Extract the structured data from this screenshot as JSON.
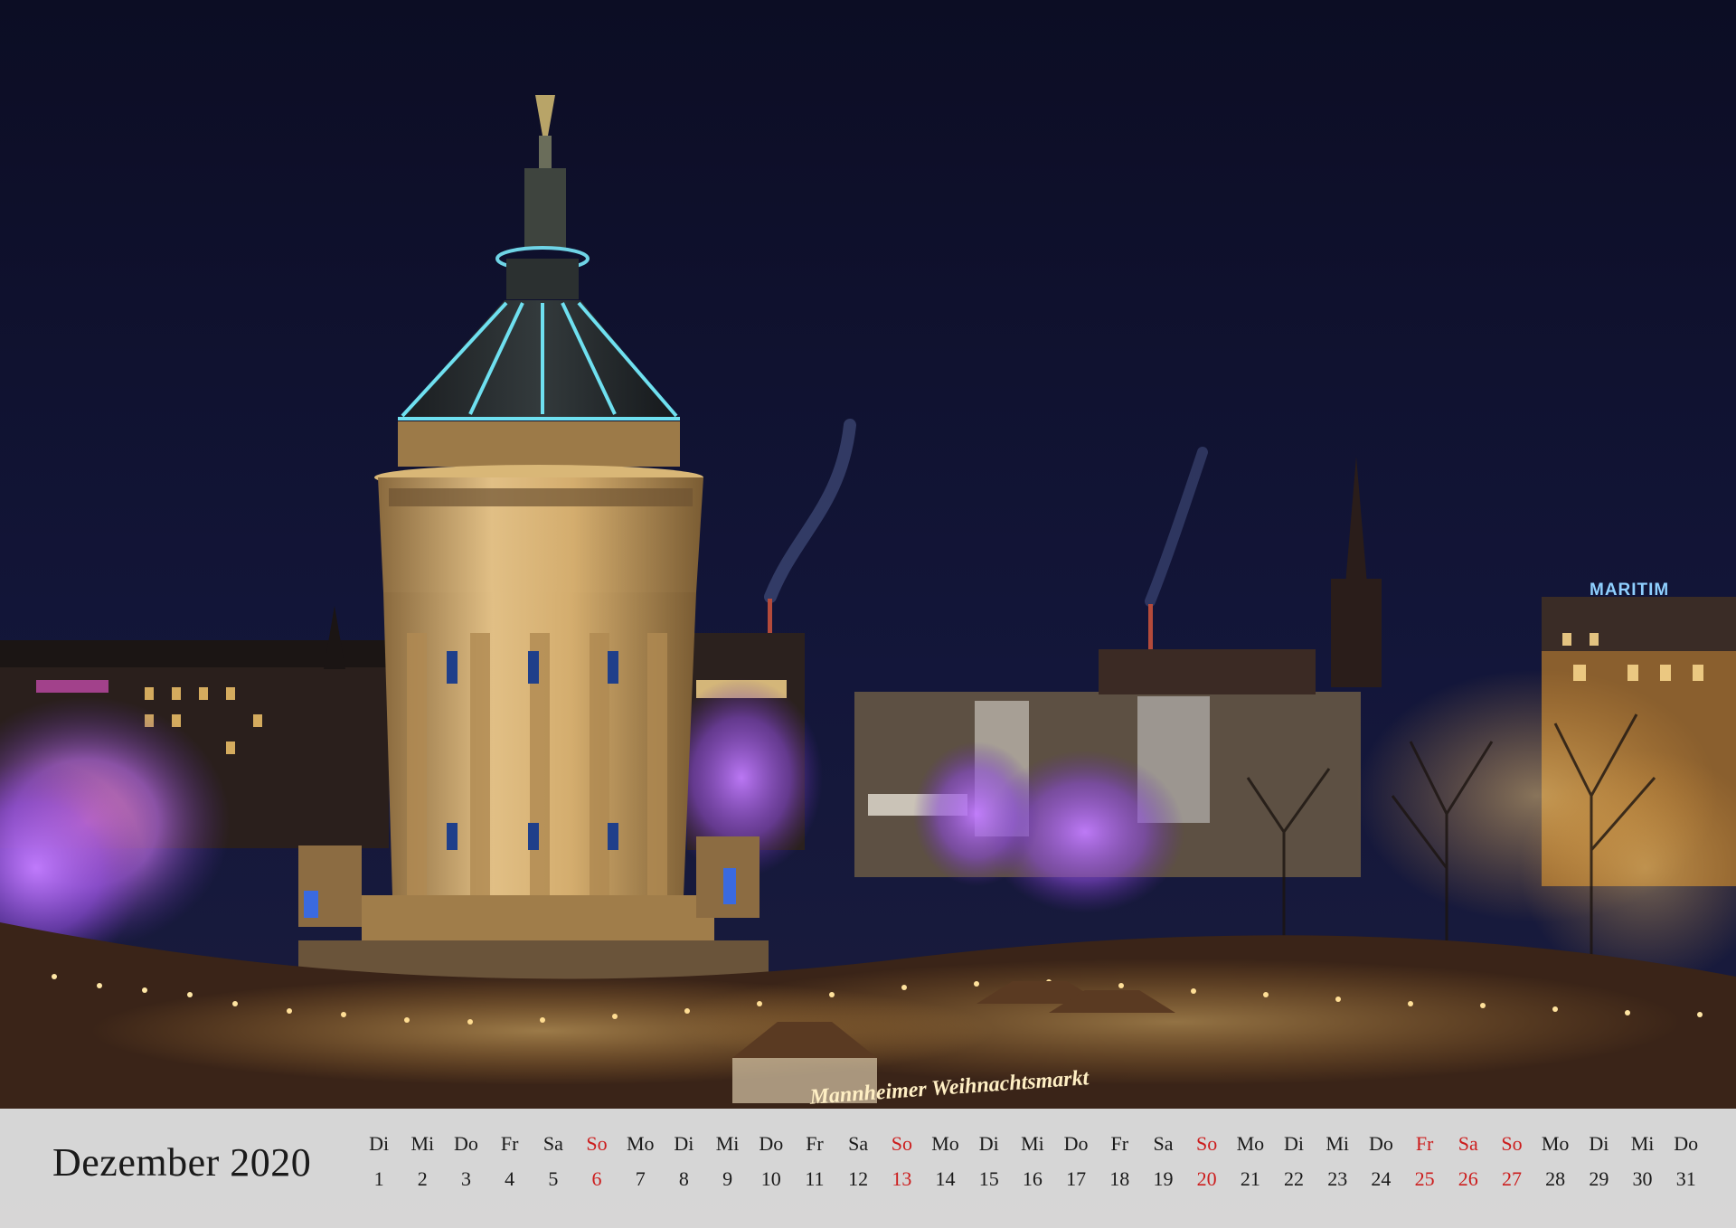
{
  "calendar": {
    "month": "Dezember 2020",
    "colors": {
      "text": "#1a1a1a",
      "holiday": "#cc1d1d"
    },
    "days": [
      {
        "weekday": "Di",
        "day": "1",
        "red": false
      },
      {
        "weekday": "Mi",
        "day": "2",
        "red": false
      },
      {
        "weekday": "Do",
        "day": "3",
        "red": false
      },
      {
        "weekday": "Fr",
        "day": "4",
        "red": false
      },
      {
        "weekday": "Sa",
        "day": "5",
        "red": false
      },
      {
        "weekday": "So",
        "day": "6",
        "red": true
      },
      {
        "weekday": "Mo",
        "day": "7",
        "red": false
      },
      {
        "weekday": "Di",
        "day": "8",
        "red": false
      },
      {
        "weekday": "Mi",
        "day": "9",
        "red": false
      },
      {
        "weekday": "Do",
        "day": "10",
        "red": false
      },
      {
        "weekday": "Fr",
        "day": "11",
        "red": false
      },
      {
        "weekday": "Sa",
        "day": "12",
        "red": false
      },
      {
        "weekday": "So",
        "day": "13",
        "red": true
      },
      {
        "weekday": "Mo",
        "day": "14",
        "red": false
      },
      {
        "weekday": "Di",
        "day": "15",
        "red": false
      },
      {
        "weekday": "Mi",
        "day": "16",
        "red": false
      },
      {
        "weekday": "Do",
        "day": "17",
        "red": false
      },
      {
        "weekday": "Fr",
        "day": "18",
        "red": false
      },
      {
        "weekday": "Sa",
        "day": "19",
        "red": false
      },
      {
        "weekday": "So",
        "day": "20",
        "red": true
      },
      {
        "weekday": "Mo",
        "day": "21",
        "red": false
      },
      {
        "weekday": "Di",
        "day": "22",
        "red": false
      },
      {
        "weekday": "Mi",
        "day": "23",
        "red": false
      },
      {
        "weekday": "Do",
        "day": "24",
        "red": false
      },
      {
        "weekday": "Fr",
        "day": "25",
        "red": true
      },
      {
        "weekday": "Sa",
        "day": "26",
        "red": true
      },
      {
        "weekday": "So",
        "day": "27",
        "red": true
      },
      {
        "weekday": "Mo",
        "day": "28",
        "red": false
      },
      {
        "weekday": "Di",
        "day": "29",
        "red": false
      },
      {
        "weekday": "Mi",
        "day": "30",
        "red": false
      },
      {
        "weekday": "Do",
        "day": "31",
        "red": false
      }
    ]
  },
  "photo": {
    "hotel_sign": "MARITIM",
    "market_sign": "Mannheimer Weihnachtsmarkt"
  }
}
